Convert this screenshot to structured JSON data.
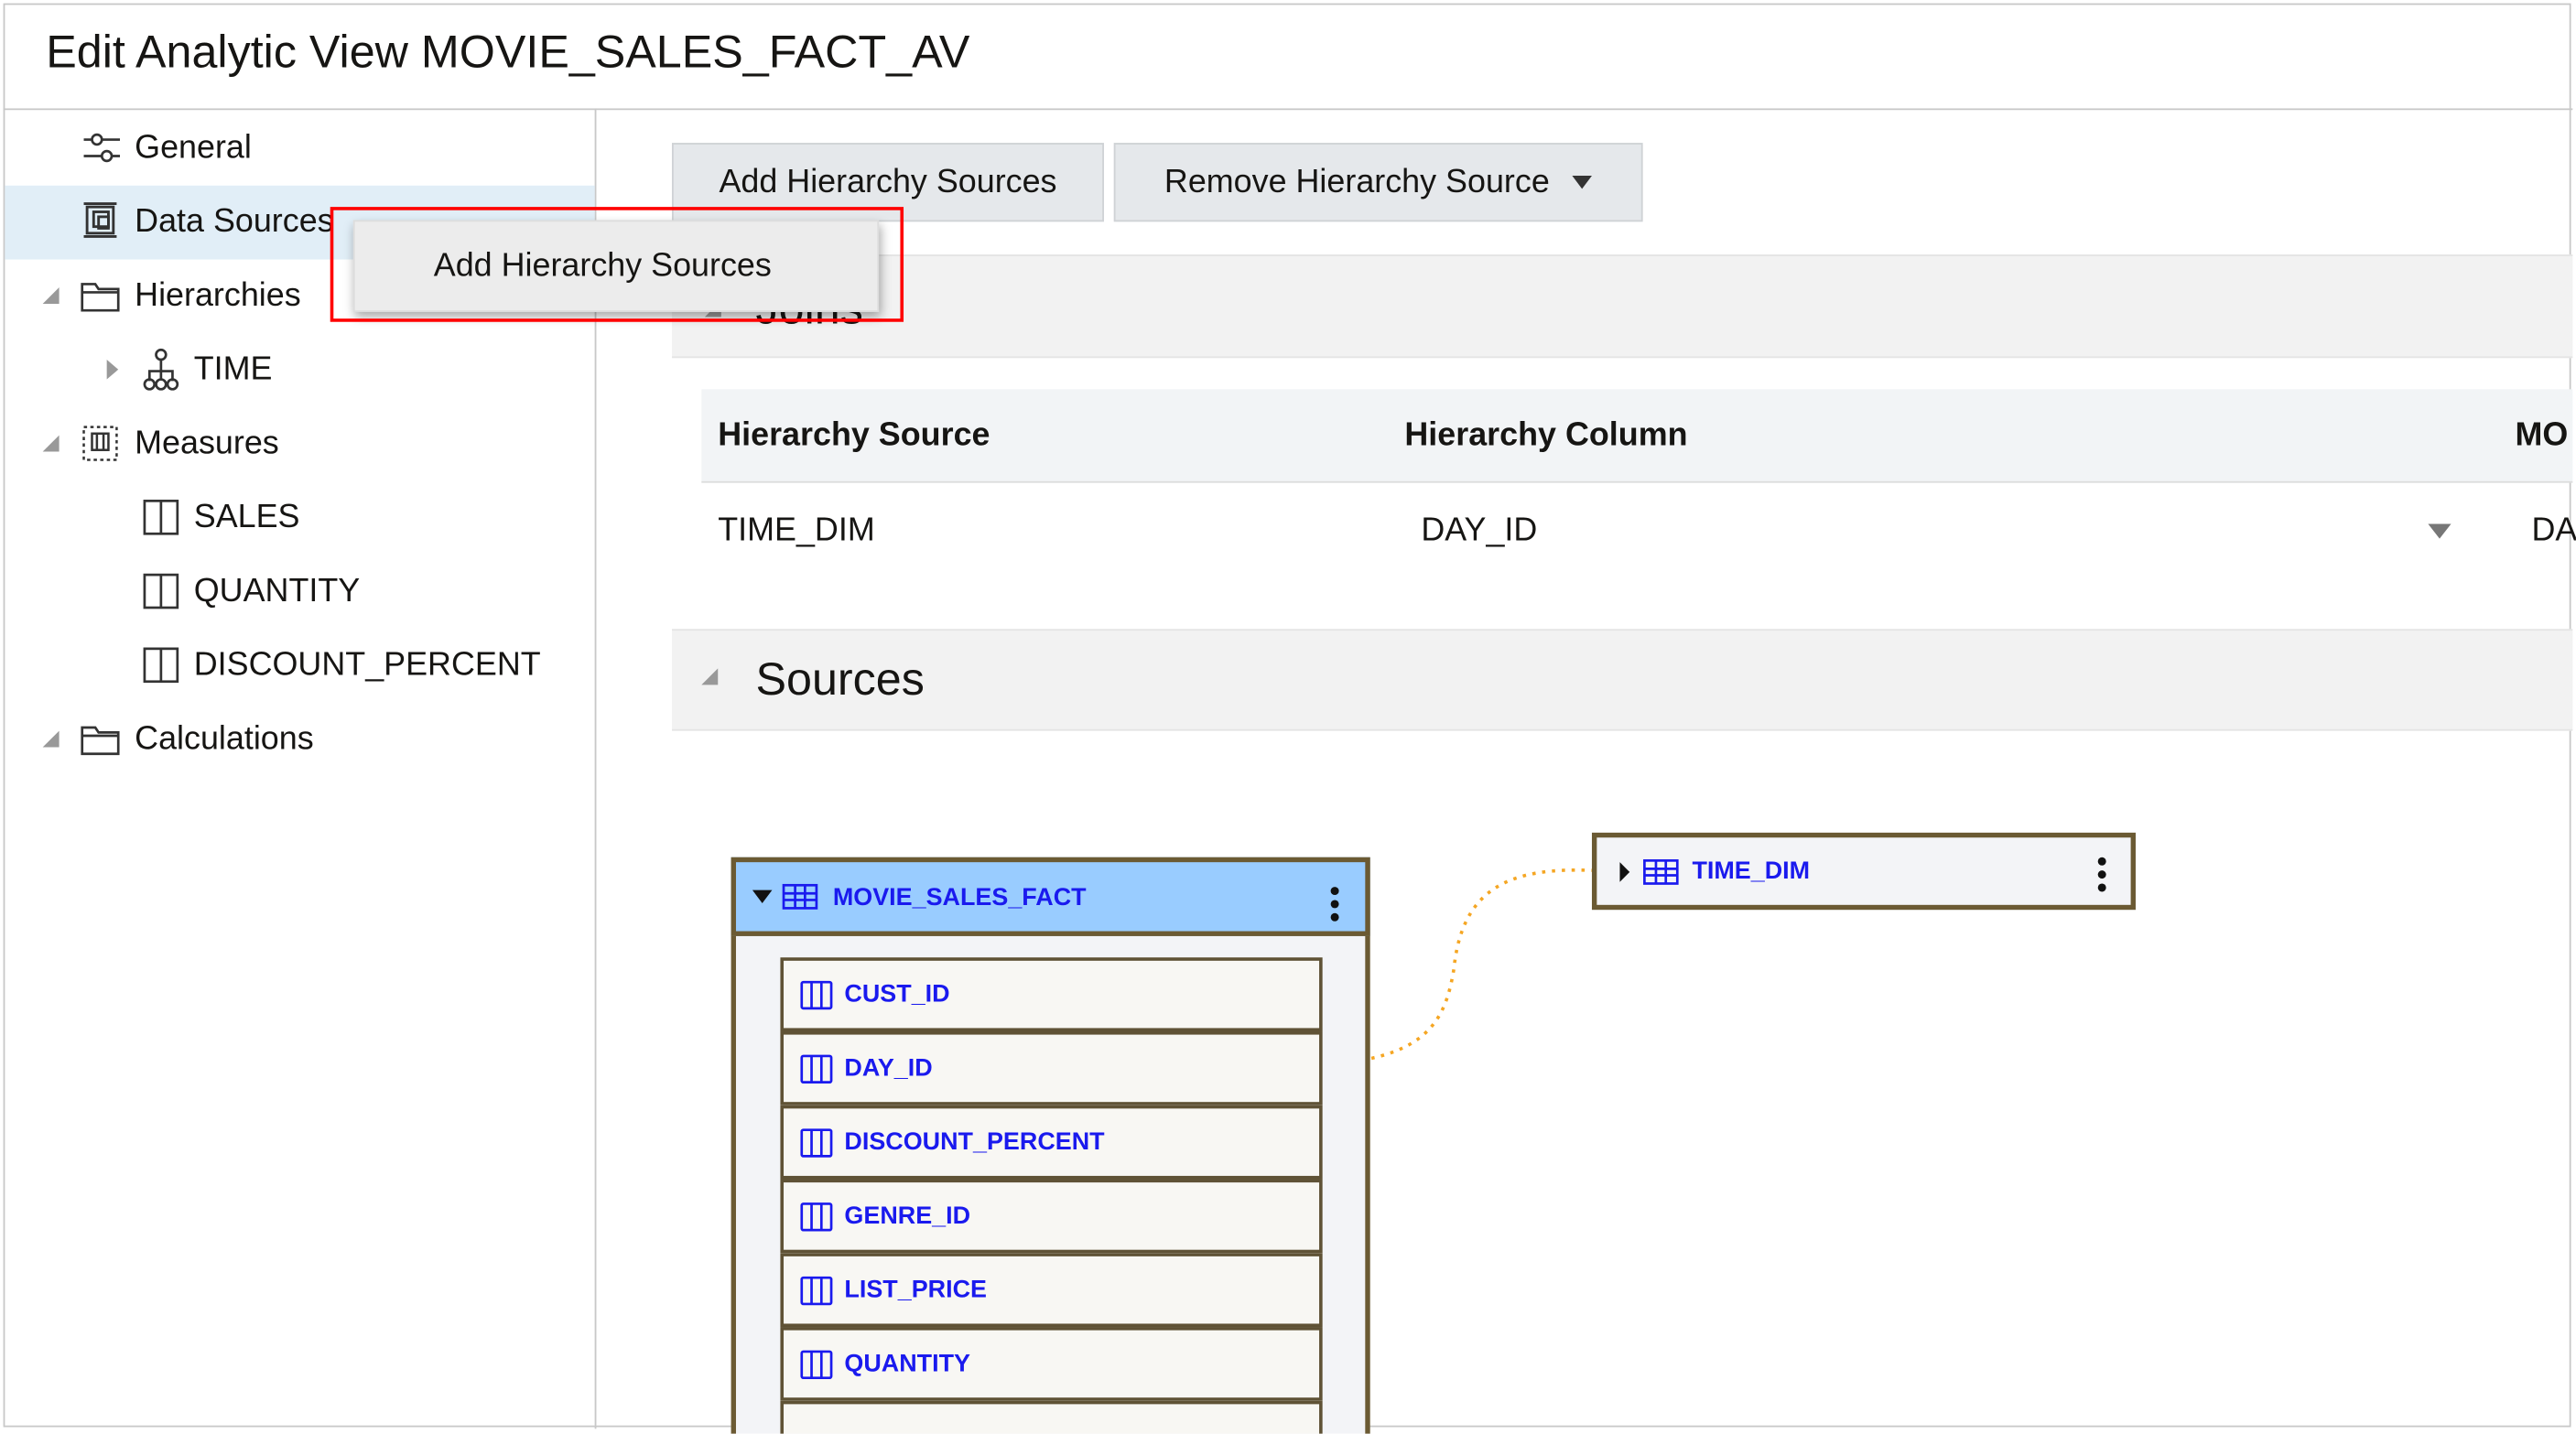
{
  "title": "Edit Analytic View MOVIE_SALES_FACT_AV",
  "sidebar": {
    "items": [
      {
        "label": "General",
        "icon": "sliders-icon"
      },
      {
        "label": "Data Sources",
        "icon": "data-sources-icon",
        "selected": true
      },
      {
        "label": "Hierarchies",
        "icon": "folder-icon"
      },
      {
        "label": "TIME",
        "icon": "hierarchy-icon"
      },
      {
        "label": "Measures",
        "icon": "measures-icon"
      },
      {
        "label": "SALES",
        "icon": "column-icon"
      },
      {
        "label": "QUANTITY",
        "icon": "column-icon"
      },
      {
        "label": "DISCOUNT_PERCENT",
        "icon": "column-icon"
      },
      {
        "label": "Calculations",
        "icon": "folder-icon"
      }
    ]
  },
  "toolbar": {
    "add_label": "Add Hierarchy Sources",
    "remove_label": "Remove Hierarchy Source"
  },
  "menu": {
    "item": "Add Hierarchy Sources"
  },
  "joins": {
    "title": "Joins",
    "headers": [
      "Hierarchy Source",
      "Hierarchy Column",
      "MO"
    ],
    "rows": [
      [
        "TIME_DIM",
        "DAY_ID",
        "DA"
      ]
    ]
  },
  "sources": {
    "title": "Sources",
    "fact": {
      "name": "MOVIE_SALES_FACT",
      "columns": [
        "CUST_ID",
        "DAY_ID",
        "DISCOUNT_PERCENT",
        "GENRE_ID",
        "LIST_PRICE",
        "QUANTITY"
      ]
    },
    "dim": {
      "name": "TIME_DIM"
    },
    "colors": {
      "header": "#99ccff",
      "border": "#6b5a33",
      "link": "#f5a623",
      "text": "#1a1aee"
    }
  }
}
